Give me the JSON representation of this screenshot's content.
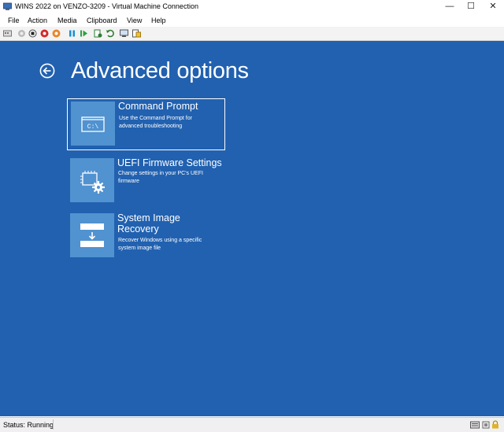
{
  "window": {
    "title": "WINS 2022 on VENZO-3209 - Virtual Machine Connection",
    "controls": {
      "minimize": "—",
      "maximize": "☐",
      "close": "✕"
    }
  },
  "menu": {
    "items": [
      {
        "label": "File"
      },
      {
        "label": "Action"
      },
      {
        "label": "Media"
      },
      {
        "label": "Clipboard"
      },
      {
        "label": "View"
      },
      {
        "label": "Help"
      }
    ]
  },
  "toolbar": {
    "buttons": [
      "ctrl-alt-del-icon",
      "start-icon",
      "turn-off-icon",
      "shutdown-icon",
      "save-icon",
      "pause-icon",
      "resume-icon",
      "checkpoint-icon",
      "revert-icon",
      "enhanced-session-icon",
      "zoom-icon"
    ]
  },
  "screen": {
    "heading": "Advanced options",
    "options": [
      {
        "title": "Command Prompt",
        "description": "Use the Command Prompt for advanced troubleshooting",
        "icon": "command-prompt-icon",
        "icon_text": "C:\\",
        "selected": true
      },
      {
        "title": "UEFI Firmware Settings",
        "description": "Change settings in your PC's UEFI firmware",
        "icon": "uefi-chip-gear-icon",
        "selected": false
      },
      {
        "title": "System Image Recovery",
        "description": "Recover Windows using a specific system image file",
        "icon": "system-image-recovery-icon",
        "selected": false
      }
    ]
  },
  "status": {
    "text": "Status: Running",
    "icons": [
      "keyboard-icon",
      "usb-icon",
      "lock-icon"
    ]
  },
  "colors": {
    "background": "#2161b0",
    "tile": "#5192d0",
    "text": "#ffffff"
  }
}
